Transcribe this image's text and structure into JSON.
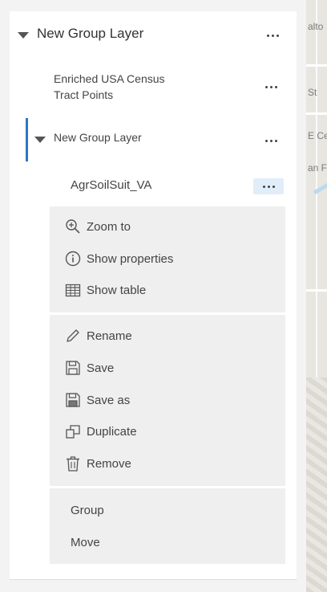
{
  "layers": {
    "top_group": {
      "title": "New Group Layer"
    },
    "enriched": {
      "title_line1": "Enriched USA Census",
      "title_line2": "Tract Points"
    },
    "nested_group": {
      "title": "New Group Layer"
    },
    "selected_layer": {
      "title": "AgrSoilSuit_VA"
    }
  },
  "context_menu": {
    "group1": [
      {
        "icon": "zoom-to-icon",
        "label": "Zoom to"
      },
      {
        "icon": "info-icon",
        "label": "Show properties"
      },
      {
        "icon": "table-icon",
        "label": "Show table"
      }
    ],
    "group2": [
      {
        "icon": "pencil-icon",
        "label": "Rename"
      },
      {
        "icon": "save-icon",
        "label": "Save"
      },
      {
        "icon": "save-as-icon",
        "label": "Save as"
      },
      {
        "icon": "duplicate-icon",
        "label": "Duplicate"
      },
      {
        "icon": "trash-icon",
        "label": "Remove"
      }
    ],
    "group3": [
      {
        "label": "Group"
      },
      {
        "label": "Move"
      }
    ]
  },
  "map_labels": [
    "alto",
    "St",
    "E Ce",
    "an F"
  ],
  "colors": {
    "accent": "#2b78c4",
    "selected_bg": "#e1edf9",
    "menu_bg": "#efefef"
  }
}
